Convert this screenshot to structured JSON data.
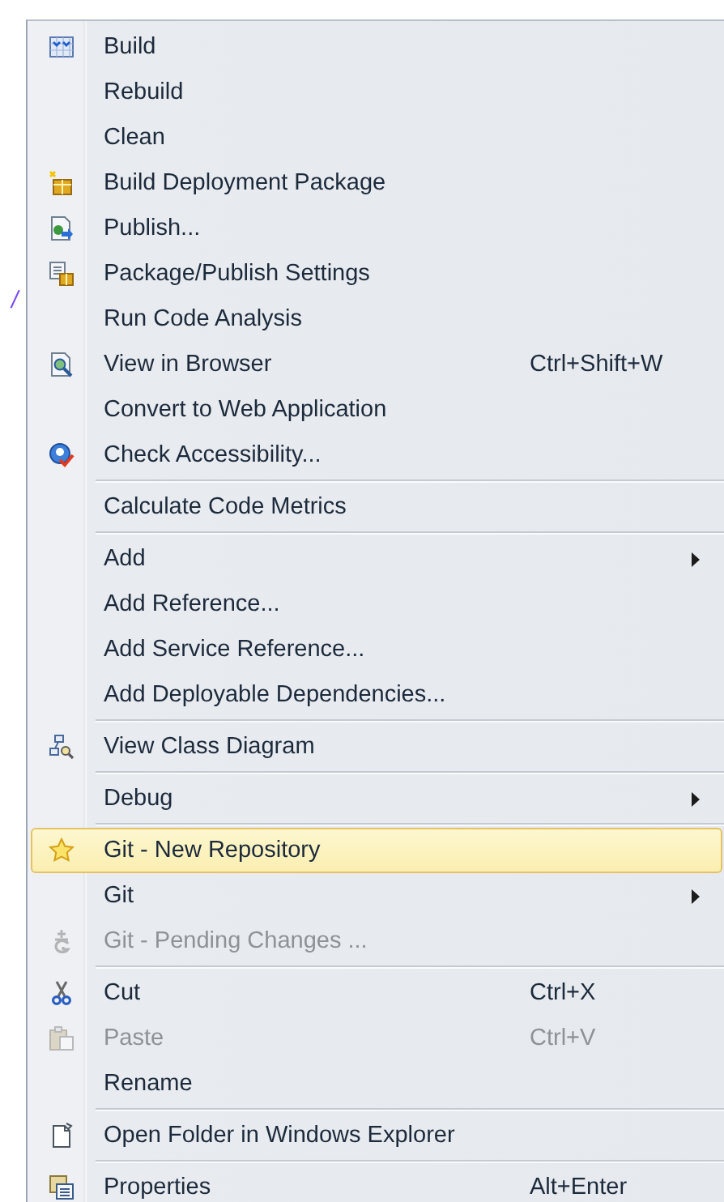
{
  "background": {
    "code_fragment": "/"
  },
  "menu": {
    "items": [
      {
        "kind": "item",
        "label": "Build",
        "submenu": false,
        "disabled": false,
        "selected": false
      },
      {
        "kind": "item",
        "label": "Rebuild",
        "submenu": false,
        "disabled": false,
        "selected": false
      },
      {
        "kind": "item",
        "label": "Clean",
        "submenu": false,
        "disabled": false,
        "selected": false
      },
      {
        "kind": "item",
        "label": "Build Deployment Package",
        "submenu": false,
        "disabled": false,
        "selected": false
      },
      {
        "kind": "item",
        "label": "Publish...",
        "submenu": false,
        "disabled": false,
        "selected": false
      },
      {
        "kind": "item",
        "label": "Package/Publish Settings",
        "submenu": false,
        "disabled": false,
        "selected": false
      },
      {
        "kind": "item",
        "label": "Run Code Analysis",
        "submenu": false,
        "disabled": false,
        "selected": false
      },
      {
        "kind": "item",
        "label": "View in Browser",
        "shortcut": "Ctrl+Shift+W",
        "submenu": false,
        "disabled": false,
        "selected": false
      },
      {
        "kind": "item",
        "label": "Convert to Web Application",
        "submenu": false,
        "disabled": false,
        "selected": false
      },
      {
        "kind": "item",
        "label": "Check Accessibility...",
        "submenu": false,
        "disabled": false,
        "selected": false
      },
      {
        "kind": "separator"
      },
      {
        "kind": "item",
        "label": "Calculate Code Metrics",
        "submenu": false,
        "disabled": false,
        "selected": false
      },
      {
        "kind": "separator"
      },
      {
        "kind": "item",
        "label": "Add",
        "submenu": true,
        "disabled": false,
        "selected": false
      },
      {
        "kind": "item",
        "label": "Add Reference...",
        "submenu": false,
        "disabled": false,
        "selected": false
      },
      {
        "kind": "item",
        "label": "Add Service Reference...",
        "submenu": false,
        "disabled": false,
        "selected": false
      },
      {
        "kind": "item",
        "label": "Add Deployable Dependencies...",
        "submenu": false,
        "disabled": false,
        "selected": false
      },
      {
        "kind": "separator"
      },
      {
        "kind": "item",
        "label": "View Class Diagram",
        "submenu": false,
        "disabled": false,
        "selected": false
      },
      {
        "kind": "separator"
      },
      {
        "kind": "item",
        "label": "Debug",
        "submenu": true,
        "disabled": false,
        "selected": false
      },
      {
        "kind": "separator"
      },
      {
        "kind": "item",
        "label": "Git - New Repository",
        "submenu": false,
        "disabled": false,
        "selected": true
      },
      {
        "kind": "item",
        "label": "Git",
        "submenu": true,
        "disabled": false,
        "selected": false
      },
      {
        "kind": "item",
        "label": "Git - Pending Changes ...",
        "submenu": false,
        "disabled": true,
        "selected": false
      },
      {
        "kind": "separator"
      },
      {
        "kind": "item",
        "label": "Cut",
        "shortcut": "Ctrl+X",
        "submenu": false,
        "disabled": false,
        "selected": false
      },
      {
        "kind": "item",
        "label": "Paste",
        "shortcut": "Ctrl+V",
        "submenu": false,
        "disabled": true,
        "selected": false
      },
      {
        "kind": "item",
        "label": "Rename",
        "submenu": false,
        "disabled": false,
        "selected": false
      },
      {
        "kind": "separator"
      },
      {
        "kind": "item",
        "label": "Open Folder in Windows Explorer",
        "submenu": false,
        "disabled": false,
        "selected": false
      },
      {
        "kind": "separator"
      },
      {
        "kind": "item",
        "label": "Properties",
        "shortcut": "Alt+Enter",
        "submenu": false,
        "disabled": false,
        "selected": false
      }
    ]
  }
}
